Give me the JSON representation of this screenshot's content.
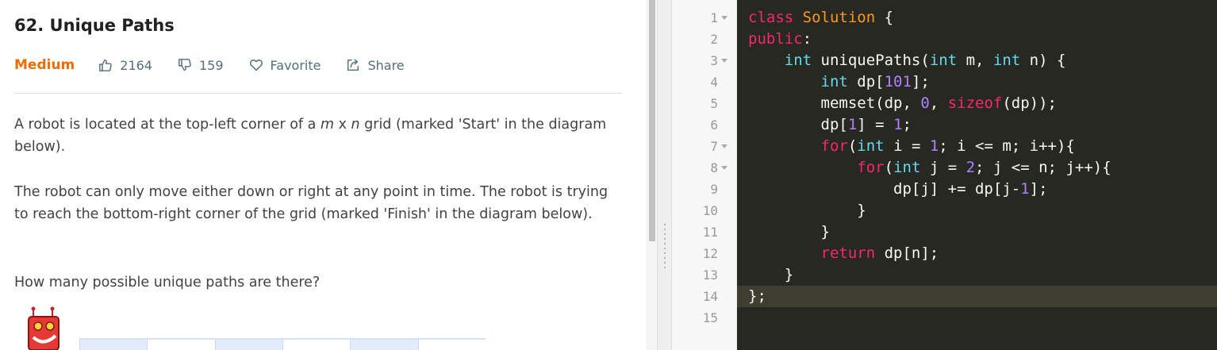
{
  "problem": {
    "title": "62. Unique Paths",
    "difficulty": "Medium",
    "likes": "2164",
    "dislikes": "159",
    "favorite_label": "Favorite",
    "share_label": "Share",
    "paragraphs": [
      [
        "A robot is located at the top-left corner of a ",
        "m",
        " x ",
        "n",
        " grid (marked 'Start' in the diagram below)."
      ],
      [
        "The robot can only move either down or right at any point in time. The robot is trying to reach the bottom-right corner of the grid (marked 'Finish' in the diagram below)."
      ],
      [
        "How many possible unique paths are there?"
      ]
    ]
  },
  "editor": {
    "line_numbers": [
      "1",
      "2",
      "3",
      "4",
      "5",
      "6",
      "7",
      "8",
      "9",
      "10",
      "11",
      "12",
      "13",
      "14",
      "15"
    ],
    "fold_lines": [
      1,
      3,
      7,
      8
    ],
    "active_line": 14,
    "code_lines": [
      [
        [
          "kw",
          "class"
        ],
        [
          "p",
          " "
        ],
        [
          "cls",
          "Solution"
        ],
        [
          "p",
          " {"
        ]
      ],
      [
        [
          "kw",
          "public"
        ],
        [
          "p",
          ":"
        ]
      ],
      [
        [
          "p",
          "    "
        ],
        [
          "type",
          "int"
        ],
        [
          "p",
          " uniquePaths("
        ],
        [
          "type",
          "int"
        ],
        [
          "p",
          " m, "
        ],
        [
          "type",
          "int"
        ],
        [
          "p",
          " n) {"
        ]
      ],
      [
        [
          "p",
          "        "
        ],
        [
          "type",
          "int"
        ],
        [
          "p",
          " dp["
        ],
        [
          "num",
          "101"
        ],
        [
          "p",
          "];"
        ]
      ],
      [
        [
          "p",
          "        memset(dp, "
        ],
        [
          "num",
          "0"
        ],
        [
          "p",
          ", "
        ],
        [
          "kw",
          "sizeof"
        ],
        [
          "p",
          "(dp));"
        ]
      ],
      [
        [
          "p",
          "        dp["
        ],
        [
          "num",
          "1"
        ],
        [
          "p",
          "] = "
        ],
        [
          "num",
          "1"
        ],
        [
          "p",
          ";"
        ]
      ],
      [
        [
          "p",
          "        "
        ],
        [
          "kw",
          "for"
        ],
        [
          "p",
          "("
        ],
        [
          "type",
          "int"
        ],
        [
          "p",
          " i = "
        ],
        [
          "num",
          "1"
        ],
        [
          "p",
          "; i <= m; i++){"
        ]
      ],
      [
        [
          "p",
          "            "
        ],
        [
          "kw",
          "for"
        ],
        [
          "p",
          "("
        ],
        [
          "type",
          "int"
        ],
        [
          "p",
          " j = "
        ],
        [
          "num",
          "2"
        ],
        [
          "p",
          "; j <= n; j++){"
        ]
      ],
      [
        [
          "p",
          "                dp[j] += dp[j-"
        ],
        [
          "num",
          "1"
        ],
        [
          "p",
          "];"
        ]
      ],
      [
        [
          "p",
          "            }"
        ]
      ],
      [
        [
          "p",
          "        }"
        ]
      ],
      [
        [
          "p",
          "        "
        ],
        [
          "kw",
          "return"
        ],
        [
          "p",
          " dp[n];"
        ]
      ],
      [
        [
          "p",
          "    }"
        ]
      ],
      [
        [
          "p",
          "};"
        ]
      ],
      [
        [
          "p",
          ""
        ]
      ]
    ]
  },
  "colors": {
    "difficulty_medium": "#ef6c00",
    "editor_background": "#272822",
    "keyword": "#f92672",
    "type": "#66d9ef",
    "number": "#ae81ff"
  },
  "icons": {
    "like": "thumbs-up-icon",
    "dislike": "thumbs-down-icon",
    "favorite": "heart-icon",
    "share": "share-icon"
  }
}
